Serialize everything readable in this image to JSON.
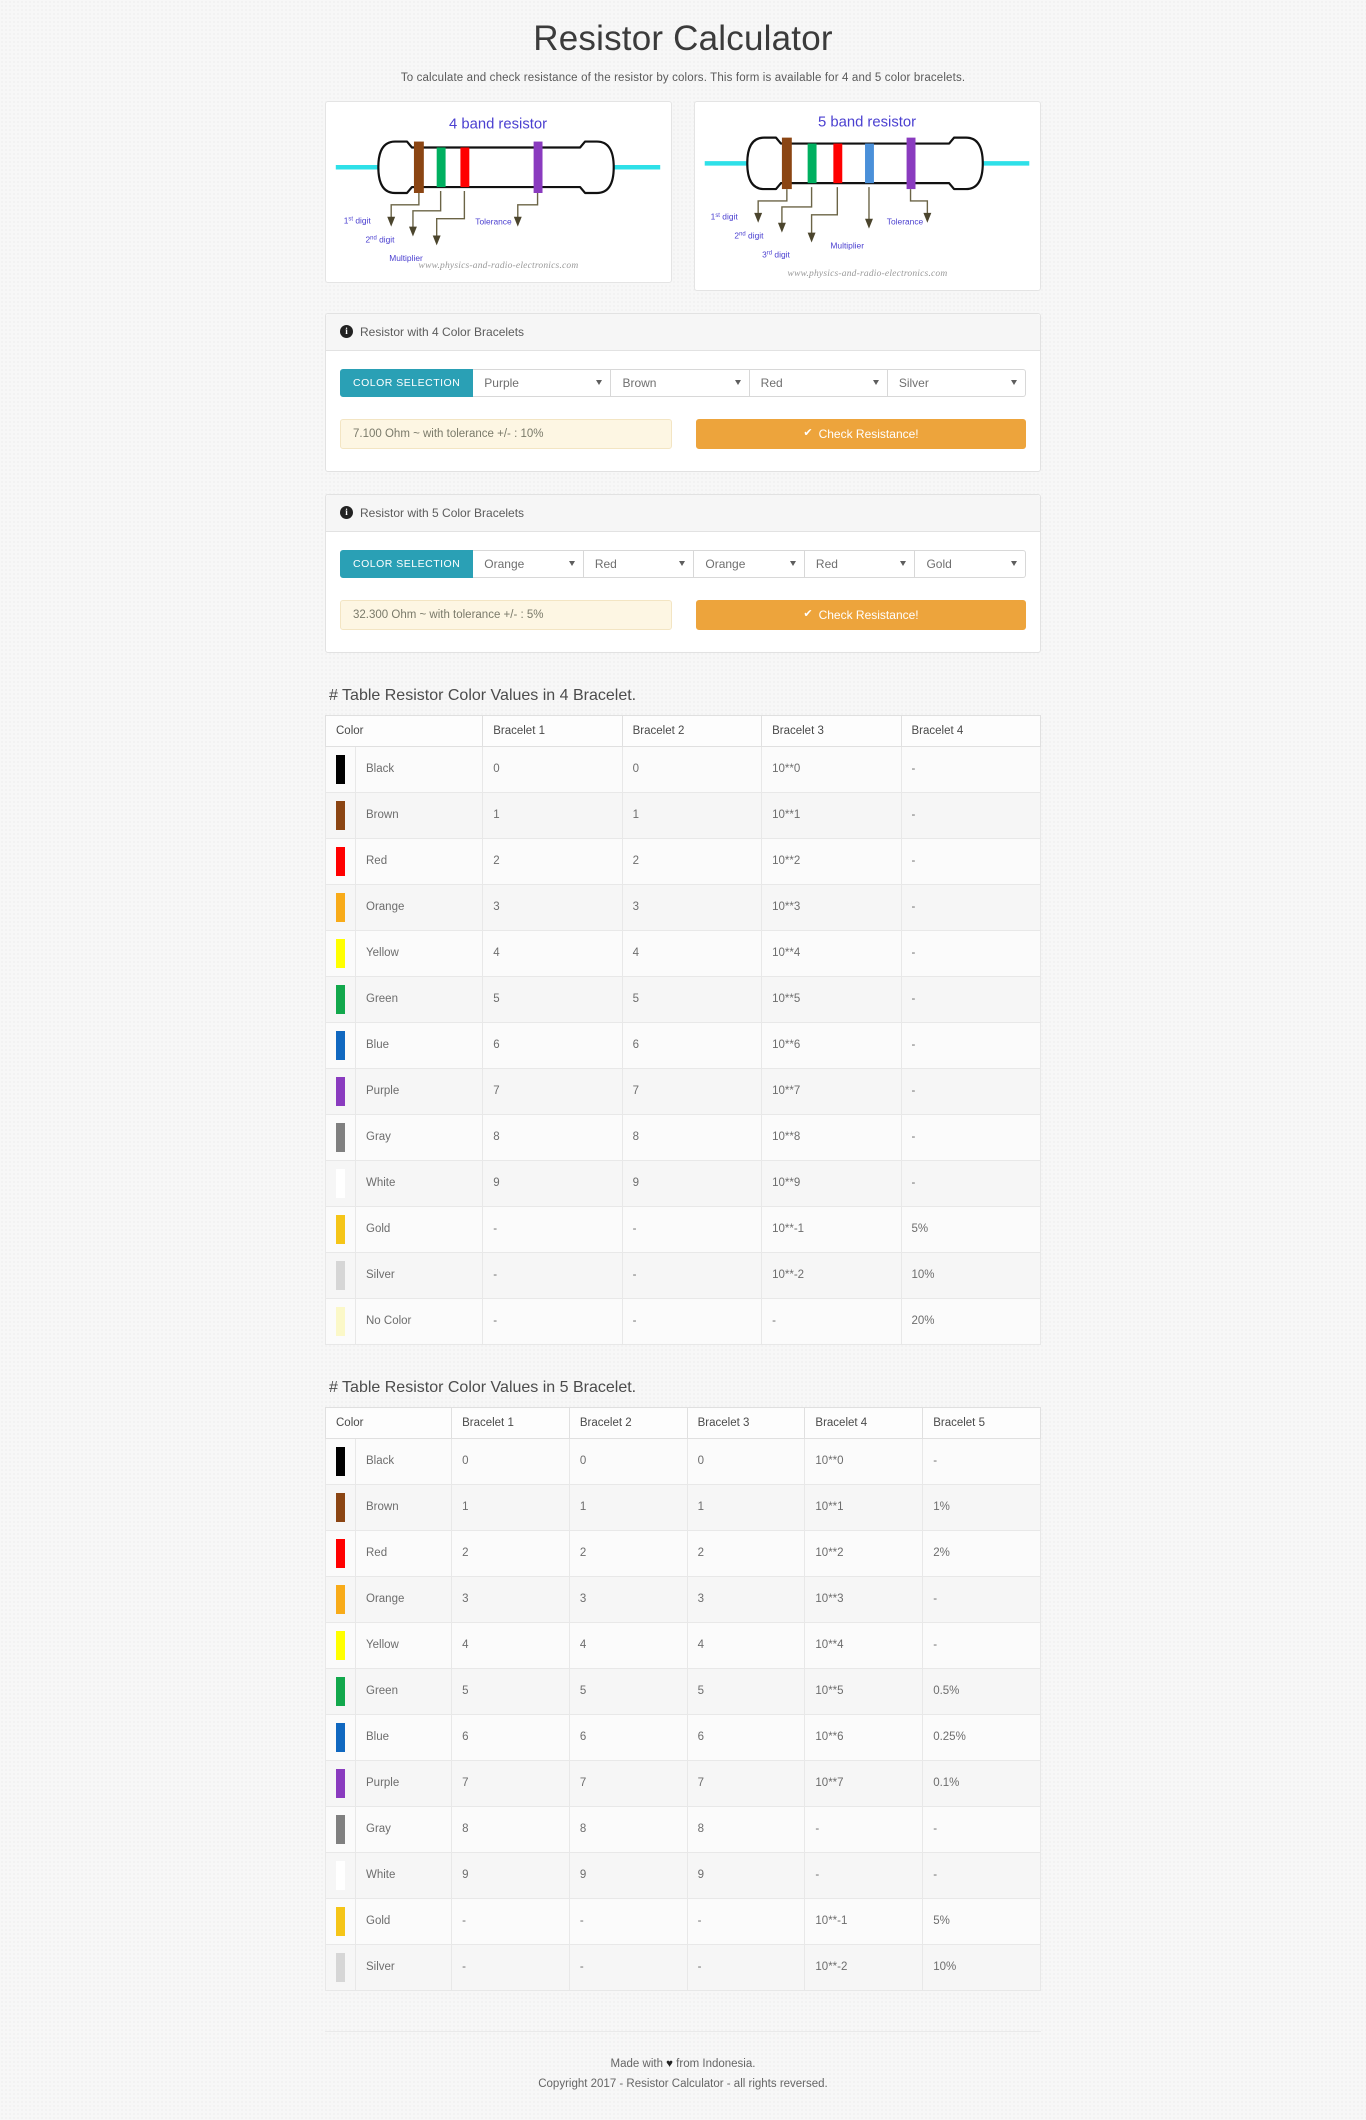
{
  "header": {
    "title": "Resistor Calculator",
    "subtitle": "To calculate and check resistance of the resistor by colors. This form is available for 4 and 5 color bracelets."
  },
  "diagrams": {
    "four": {
      "title": "4 band resistor",
      "watermark": "www.physics-and-radio-electronics.com",
      "bands": [
        "#8B4513",
        "#00b060",
        "#ff0000",
        "#8a3bbf"
      ],
      "labels": [
        "1st digit",
        "2nd digit",
        "Multiplier",
        "Tolerance"
      ],
      "label_sup": [
        "st",
        "nd",
        "",
        ""
      ],
      "label_base": [
        "1",
        "2",
        "Multiplier",
        "Tolerance"
      ]
    },
    "five": {
      "title": "5 band resistor",
      "watermark": "www.physics-and-radio-electronics.com",
      "bands": [
        "#8B4513",
        "#00b060",
        "#ff0000",
        "#4a90d9",
        "#8a3bbf"
      ],
      "labels": [
        "1st digit",
        "2nd digit",
        "3rd digit",
        "Multiplier",
        "Tolerance"
      ],
      "label_base": [
        "1",
        "2",
        "3",
        "Multiplier",
        "Tolerance"
      ],
      "label_sup": [
        "st",
        "nd",
        "rd",
        "",
        ""
      ]
    },
    "lead_color": "#2ee0e8"
  },
  "form4": {
    "panel_title": "Resistor with 4 Color Bracelets",
    "group_label": "COLOR SELECTION",
    "selects": [
      {
        "name": "bracelet-1",
        "value": "Purple"
      },
      {
        "name": "bracelet-2",
        "value": "Brown"
      },
      {
        "name": "bracelet-3",
        "value": "Red"
      },
      {
        "name": "bracelet-4",
        "value": "Silver"
      }
    ],
    "result": "7.100 Ohm ~ with tolerance +/- : 10%",
    "button_label": "Check Resistance!"
  },
  "form5": {
    "panel_title": "Resistor with 5 Color Bracelets",
    "group_label": "COLOR SELECTION",
    "selects": [
      {
        "name": "bracelet-1",
        "value": "Orange"
      },
      {
        "name": "bracelet-2",
        "value": "Red"
      },
      {
        "name": "bracelet-3",
        "value": "Orange"
      },
      {
        "name": "bracelet-4",
        "value": "Red"
      },
      {
        "name": "bracelet-5",
        "value": "Gold"
      }
    ],
    "result": "32.300 Ohm ~ with tolerance +/- : 5%",
    "button_label": "Check Resistance!"
  },
  "table4": {
    "title": "# Table Resistor Color Values in 4 Bracelet.",
    "columns": [
      "Color",
      "Bracelet 1",
      "Bracelet 2",
      "Bracelet 3",
      "Bracelet 4"
    ],
    "rows": [
      {
        "color": "Black",
        "hex": "#000000",
        "cells": [
          "0",
          "0",
          "10**0",
          "-"
        ]
      },
      {
        "color": "Brown",
        "hex": "#8B4513",
        "cells": [
          "1",
          "1",
          "10**1",
          "-"
        ]
      },
      {
        "color": "Red",
        "hex": "#ff0000",
        "cells": [
          "2",
          "2",
          "10**2",
          "-"
        ]
      },
      {
        "color": "Orange",
        "hex": "#f8ab19",
        "cells": [
          "3",
          "3",
          "10**3",
          "-"
        ]
      },
      {
        "color": "Yellow",
        "hex": "#ffff00",
        "cells": [
          "4",
          "4",
          "10**4",
          "-"
        ]
      },
      {
        "color": "Green",
        "hex": "#12a84c",
        "cells": [
          "5",
          "5",
          "10**5",
          "-"
        ]
      },
      {
        "color": "Blue",
        "hex": "#1068c0",
        "cells": [
          "6",
          "6",
          "10**6",
          "-"
        ]
      },
      {
        "color": "Purple",
        "hex": "#8a3bbf",
        "cells": [
          "7",
          "7",
          "10**7",
          "-"
        ]
      },
      {
        "color": "Gray",
        "hex": "#808080",
        "cells": [
          "8",
          "8",
          "10**8",
          "-"
        ]
      },
      {
        "color": "White",
        "hex": "#ffffff",
        "cells": [
          "9",
          "9",
          "10**9",
          "-"
        ]
      },
      {
        "color": "Gold",
        "hex": "#f5c518",
        "cells": [
          "-",
          "-",
          "10**-1",
          "5%"
        ]
      },
      {
        "color": "Silver",
        "hex": "#d6d6d6",
        "cells": [
          "-",
          "-",
          "10**-2",
          "10%"
        ]
      },
      {
        "color": "No Color",
        "hex": "#fbf8c8",
        "cells": [
          "-",
          "-",
          "-",
          "20%"
        ]
      }
    ]
  },
  "table5": {
    "title": "# Table Resistor Color Values in 5 Bracelet.",
    "columns": [
      "Color",
      "Bracelet 1",
      "Bracelet 2",
      "Bracelet 3",
      "Bracelet 4",
      "Bracelet 5"
    ],
    "rows": [
      {
        "color": "Black",
        "hex": "#000000",
        "cells": [
          "0",
          "0",
          "0",
          "10**0",
          "-"
        ]
      },
      {
        "color": "Brown",
        "hex": "#8B4513",
        "cells": [
          "1",
          "1",
          "1",
          "10**1",
          "1%"
        ]
      },
      {
        "color": "Red",
        "hex": "#ff0000",
        "cells": [
          "2",
          "2",
          "2",
          "10**2",
          "2%"
        ]
      },
      {
        "color": "Orange",
        "hex": "#f8ab19",
        "cells": [
          "3",
          "3",
          "3",
          "10**3",
          "-"
        ]
      },
      {
        "color": "Yellow",
        "hex": "#ffff00",
        "cells": [
          "4",
          "4",
          "4",
          "10**4",
          "-"
        ]
      },
      {
        "color": "Green",
        "hex": "#12a84c",
        "cells": [
          "5",
          "5",
          "5",
          "10**5",
          "0.5%"
        ]
      },
      {
        "color": "Blue",
        "hex": "#1068c0",
        "cells": [
          "6",
          "6",
          "6",
          "10**6",
          "0.25%"
        ]
      },
      {
        "color": "Purple",
        "hex": "#8a3bbf",
        "cells": [
          "7",
          "7",
          "7",
          "10**7",
          "0.1%"
        ]
      },
      {
        "color": "Gray",
        "hex": "#808080",
        "cells": [
          "8",
          "8",
          "8",
          "-",
          "-"
        ]
      },
      {
        "color": "White",
        "hex": "#ffffff",
        "cells": [
          "9",
          "9",
          "9",
          "-",
          "-"
        ]
      },
      {
        "color": "Gold",
        "hex": "#f5c518",
        "cells": [
          "-",
          "-",
          "-",
          "10**-1",
          "5%"
        ]
      },
      {
        "color": "Silver",
        "hex": "#d6d6d6",
        "cells": [
          "-",
          "-",
          "-",
          "10**-2",
          "10%"
        ]
      }
    ]
  },
  "footer": {
    "line1_before": "Made with ",
    "heart": "♥",
    "line1_after": " from Indonesia.",
    "line2": "Copyright 2017 - Resistor Calculator - all rights reversed."
  },
  "colors": {
    "accent_teal": "#2aa0b5",
    "accent_orange": "#eda43c",
    "result_bg": "#fdf6e3",
    "diagram_label": "#4a3fd0"
  }
}
